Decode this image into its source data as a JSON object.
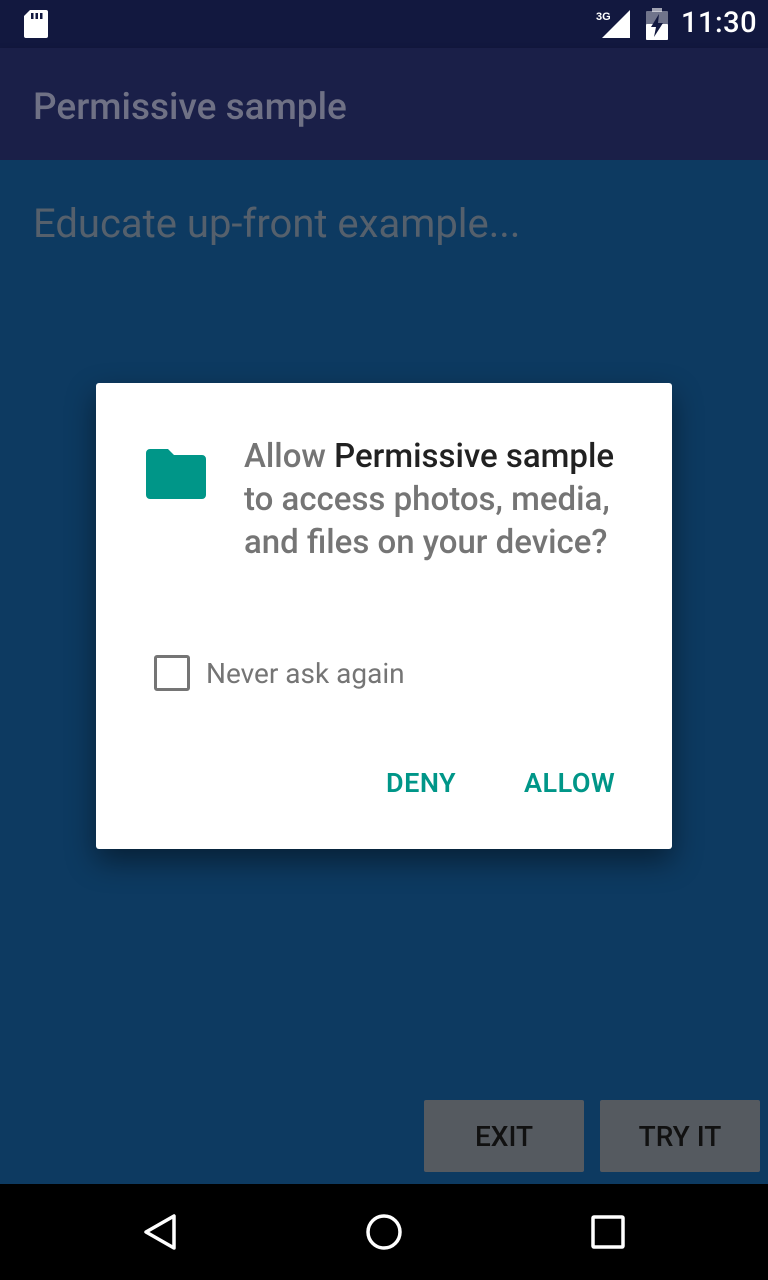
{
  "status_bar": {
    "network_label": "3G",
    "time": "11:30"
  },
  "app_bar": {
    "title": "Permissive sample"
  },
  "main": {
    "lead_text": "Educate up-front example..."
  },
  "bottom_buttons": {
    "exit": "EXIT",
    "try_it": "TRY IT"
  },
  "dialog": {
    "icon": "folder-icon",
    "message_prefix": "Allow ",
    "app_name": "Permissive sample",
    "message_suffix": " to access photos, media, and files on your device?",
    "never_ask_label": "Never ask again",
    "never_ask_checked": false,
    "deny": "DENY",
    "allow": "ALLOW",
    "accent_color": "#009688"
  }
}
